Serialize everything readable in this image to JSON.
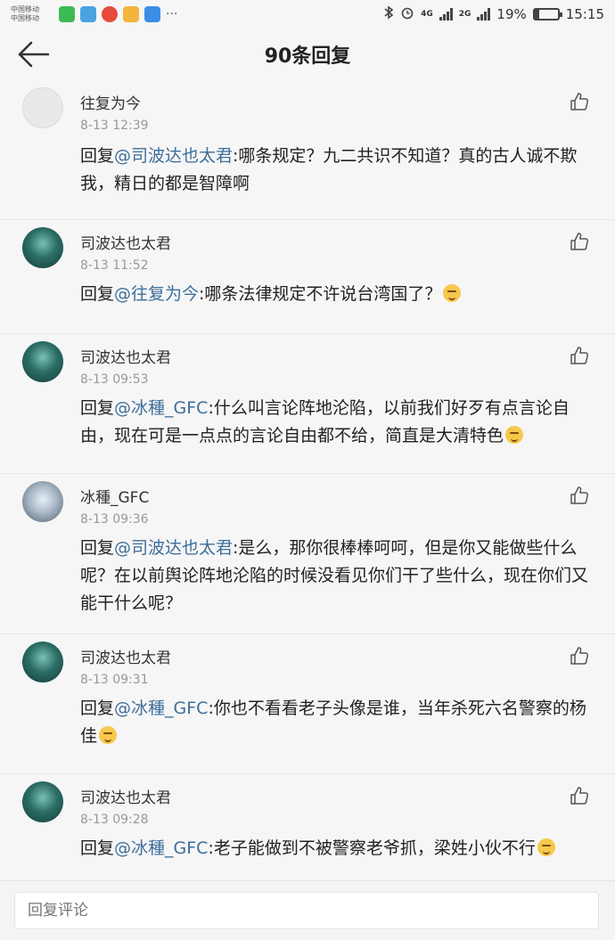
{
  "status_bar": {
    "carrier_1": "中国移动",
    "carrier_2": "中国移动",
    "network_1": "4G",
    "network_2": "2G",
    "battery": "19%",
    "battery_level": 0.19,
    "time": "15:15",
    "more": "···"
  },
  "header": {
    "title": "90条回复"
  },
  "comments": [
    {
      "username": "往复为今",
      "time": "8-13 12:39",
      "prefix": "回复",
      "mention": "@司波达也太君",
      "text": ":哪条规定？九二共识不知道？真的古人诚不欺我，精日的都是智障啊"
    },
    {
      "username": "司波达也太君",
      "time": "8-13 11:52",
      "prefix": "回复",
      "mention": "@往复为今",
      "text": ":哪条法律规定不许说台湾国了？"
    },
    {
      "username": "司波达也太君",
      "time": "8-13 09:53",
      "prefix": "回复",
      "mention": "@冰種_GFC",
      "text": ":什么叫言论阵地沦陷，以前我们好歹有点言论自由，现在可是一点点的言论自由都不给，简直是大清特色"
    },
    {
      "username": "冰種_GFC",
      "time": "8-13 09:36",
      "prefix": "回复",
      "mention": "@司波达也太君",
      "text": ":是么，那你很棒棒呵呵，但是你又能做些什么呢？在以前舆论阵地沦陷的时候没看见你们干了些什么，现在你们又能干什么呢？"
    },
    {
      "username": "司波达也太君",
      "time": "8-13 09:31",
      "prefix": "回复",
      "mention": "@冰種_GFC",
      "text": ":你也不看看老子头像是谁，当年杀死六名警察的杨佳"
    },
    {
      "username": "司波达也太君",
      "time": "8-13 09:28",
      "prefix": "回复",
      "mention": "@冰種_GFC",
      "text": ":老子能做到不被警察老爷抓，梁姓小伙不行"
    }
  ],
  "reply_bar": {
    "placeholder": "回复评论"
  },
  "icons": {
    "back": "back-arrow-icon",
    "like": "thumbs-up-icon",
    "emoji": "smirk-emoji-icon"
  }
}
